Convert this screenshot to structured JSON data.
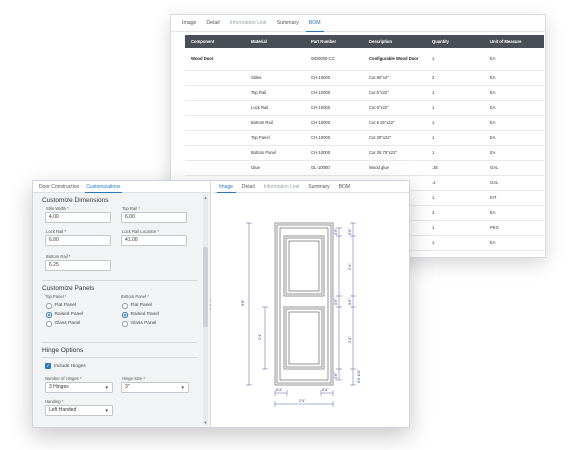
{
  "back_window": {
    "tabs": [
      {
        "label": "Image",
        "state": "normal"
      },
      {
        "label": "Detail",
        "state": "normal"
      },
      {
        "label": "Information Link",
        "state": "dim"
      },
      {
        "label": "Summary",
        "state": "normal"
      },
      {
        "label": "BOM",
        "state": "active"
      }
    ],
    "bom": {
      "columns": [
        "Component",
        "Material",
        "Part Number",
        "Description",
        "Quantity",
        "Unit of Measure"
      ],
      "rows": [
        [
          "Wood Door",
          "",
          "WD0000-CC",
          "Configurable Wood Door",
          "1",
          "EA"
        ],
        [
          "",
          "Stiles",
          "CH-10000",
          "Cut 80\"x4\"",
          "2",
          "EA"
        ],
        [
          "",
          "Top Rail",
          "CH-10000",
          "Cut 6\"x22\"",
          "1",
          "EA"
        ],
        [
          "",
          "Lock Rail",
          "CH-10000",
          "Cut 6\"x22\"",
          "1",
          "EA"
        ],
        [
          "",
          "Bottom Rail",
          "CH-10000",
          "Cut 6.25\"x22\"",
          "1",
          "EA"
        ],
        [
          "",
          "Top Panel",
          "CH-10000",
          "Cut 29\"x22\"",
          "1",
          "EA"
        ],
        [
          "",
          "Bottom Panel",
          "CH-10000",
          "Cut 28.75\"x22\"",
          "1",
          "EA"
        ],
        [
          "",
          "Glue",
          "GL-10000",
          "Wood glue",
          ".35",
          "GAL"
        ],
        [
          "",
          "Polyurethane",
          "PE-10000",
          "Satin polyurethane",
          ".4",
          "GAL"
        ],
        [
          "",
          "",
          "",
          "",
          "1",
          "KIT"
        ],
        [
          "",
          "",
          "",
          "",
          "3",
          "EA"
        ],
        [
          "",
          "",
          "",
          "hardware",
          "1",
          "PKG"
        ],
        [
          "",
          "",
          "",
          "",
          "1",
          "EA"
        ]
      ]
    }
  },
  "front_window": {
    "left_tabs": [
      {
        "label": "Door Construction",
        "state": "normal"
      },
      {
        "label": "Customizations",
        "state": "active"
      }
    ],
    "dimensions": {
      "title": "Customize Dimensions",
      "stile_width": {
        "label": "Stile Width *",
        "value": "4.00"
      },
      "top_rail": {
        "label": "Top Rail *",
        "value": "6.00"
      },
      "lock_rail": {
        "label": "Lock Rail *",
        "value": "6.00"
      },
      "lock_rail_location": {
        "label": "Lock Rail Location *",
        "value": "41.00"
      },
      "bottom_rail": {
        "label": "Bottom Rail *",
        "value": "6.25"
      }
    },
    "panels": {
      "title": "Customize Panels",
      "top_panel_label": "Top Panel *",
      "bottom_panel_label": "Bottom Panel *",
      "top_options": [
        {
          "label": "Flat Panel",
          "selected": false
        },
        {
          "label": "Raised Panel",
          "selected": true
        },
        {
          "label": "Glass Panel",
          "selected": false
        }
      ],
      "bottom_options": [
        {
          "label": "Flat Panel",
          "selected": false
        },
        {
          "label": "Raised Panel",
          "selected": true
        },
        {
          "label": "Glass Panel",
          "selected": false
        }
      ]
    },
    "hinges": {
      "title": "Hinge Options",
      "include_label": "Include Hinges",
      "include_checked": true,
      "number_label": "Number of Hinges *",
      "number_value": "3 Hinges",
      "size_label": "Hinge Size *",
      "size_value": "3\"",
      "handing_label": "Handing *",
      "handing_value": "Left Handed"
    },
    "right_tabs": [
      {
        "label": "Image",
        "state": "active"
      },
      {
        "label": "Detail",
        "state": "normal"
      },
      {
        "label": "Information Link",
        "state": "dim"
      },
      {
        "label": "Summary",
        "state": "normal"
      },
      {
        "label": "BOM",
        "state": "normal"
      }
    ],
    "drawing": {
      "dims": {
        "overall_height": "6'8\"",
        "panel_height": "2'4\"",
        "top_rail": "0'6\"",
        "top_rail_r": "0'6\"",
        "upper_right": "2'4\"",
        "lock_rail": "0'6\"",
        "lock_rail_r": "0'6\"",
        "lower_right": "2'4\"",
        "bottom_rail": "0'6\"",
        "bottom_rail_r": "0'6 1/4\"",
        "stile_left": "0'4\"",
        "stile_right": "0'4\"",
        "overall_width": "2'4\""
      },
      "line_color": "#2b3a8c"
    },
    "accent_color": "#2a7ab8"
  }
}
